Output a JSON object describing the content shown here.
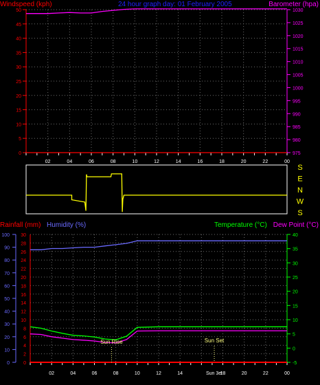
{
  "header": {
    "windspeed_label": "Windspeed (kph)",
    "title": "24 hour graph day: 01 February 2005",
    "barometer_label": "Barometer (hpa)"
  },
  "lower_header": {
    "rainfall_label": "Rainfall (mm)",
    "humidity_label": "Humidity (%)",
    "temperature_label": "Temperature (°C)",
    "dewpoint_label": "Dew Point (°C)"
  },
  "compass": [
    "S",
    "E",
    "N",
    "W",
    "S"
  ],
  "x_ticks": [
    "02",
    "04",
    "06",
    "08",
    "10",
    "12",
    "14",
    "16",
    "18",
    "20",
    "22",
    "00"
  ],
  "annotations": {
    "sun_rise": "Sun Rise",
    "sun_set": "Sun Set",
    "sun_set_axis": "Sun 3et"
  },
  "colors": {
    "background": "#000000",
    "grid": "#6e6e6e",
    "windspeed": "#ff0000",
    "barometer": "#ff00ff",
    "title": "#2020ff",
    "wind_direction": "#ffff00",
    "humidity": "#6a6aff",
    "temperature": "#00ff00",
    "dewpoint": "#ff00ff",
    "rainfall": "#ff0000"
  },
  "chart_data": [
    {
      "type": "line",
      "panel": "top",
      "title": "24 hour graph day: 01 February 2005",
      "xlabel": "",
      "x_ticks": [
        "02",
        "04",
        "06",
        "08",
        "10",
        "12",
        "14",
        "16",
        "18",
        "20",
        "22",
        "00"
      ],
      "xlim": [
        0,
        24
      ],
      "left_axis": {
        "label": "Windspeed (kph)",
        "ylim": [
          0,
          50
        ],
        "ticks": [
          0,
          5,
          10,
          15,
          20,
          25,
          30,
          35,
          40,
          45,
          50
        ]
      },
      "right_axis": {
        "label": "Barometer (hpa)",
        "ylim": [
          975,
          1030
        ],
        "ticks": [
          975,
          980,
          985,
          990,
          995,
          1000,
          1005,
          1010,
          1015,
          1020,
          1025,
          1030
        ]
      },
      "grid": true,
      "series": [
        {
          "name": "Windspeed (kph)",
          "axis": "left",
          "points": [
            [
              0,
              0
            ],
            [
              24,
              0
            ]
          ]
        },
        {
          "name": "Barometer (hpa)",
          "axis": "right",
          "points": [
            [
              0,
              1028.5
            ],
            [
              2,
              1028.5
            ],
            [
              3,
              1028.7
            ],
            [
              4,
              1028.9
            ],
            [
              5,
              1028.7
            ],
            [
              6,
              1028.7
            ],
            [
              7,
              1029.3
            ],
            [
              8,
              1029.7
            ],
            [
              9,
              1030.1
            ],
            [
              10,
              1030.3
            ],
            [
              12,
              1030.3
            ],
            [
              14,
              1030.3
            ],
            [
              16,
              1030.3
            ],
            [
              18,
              1030.3
            ],
            [
              20,
              1030.3
            ],
            [
              22,
              1030.3
            ],
            [
              24,
              1030.3
            ]
          ]
        }
      ]
    },
    {
      "type": "line",
      "panel": "wind_direction",
      "title": "",
      "x_ticks": [],
      "xlim": [
        0,
        24
      ],
      "y_categories": [
        "S",
        "E",
        "N",
        "W",
        "S"
      ],
      "grid": false,
      "series": [
        {
          "name": "",
          "axis": "direction",
          "points": [
            [
              0,
              1.5
            ],
            [
              4.2,
              1.5
            ],
            [
              4.2,
              1.1
            ],
            [
              5.4,
              0.9
            ],
            [
              5.5,
              0.15
            ],
            [
              5.55,
              3.3
            ],
            [
              5.6,
              3.1
            ],
            [
              7.8,
              3.1
            ],
            [
              7.85,
              3.35
            ],
            [
              8.8,
              3.35
            ],
            [
              8.85,
              0.05
            ],
            [
              8.9,
              1.15
            ],
            [
              9.0,
              1.5
            ],
            [
              24,
              1.5
            ]
          ]
        }
      ]
    },
    {
      "type": "line",
      "panel": "bottom",
      "title": "",
      "x_ticks": [
        "02",
        "04",
        "06",
        "08",
        "10",
        "12",
        "14",
        "16",
        "18",
        "20",
        "22",
        "00"
      ],
      "xlim": [
        0,
        24
      ],
      "rain_axis": {
        "label": "Rainfall (mm)",
        "ylim": [
          0,
          30
        ],
        "ticks": [
          0,
          2,
          4,
          6,
          8,
          10,
          12,
          14,
          16,
          18,
          20,
          22,
          24,
          26,
          28,
          30
        ]
      },
      "humidity_axis": {
        "label": "Humidity (%)",
        "ylim": [
          0,
          100
        ],
        "ticks": [
          0,
          10,
          20,
          30,
          40,
          50,
          60,
          70,
          80,
          90,
          100
        ]
      },
      "temp_axis": {
        "label": "Temperature (°C)",
        "ylim": [
          -5,
          40
        ],
        "ticks": [
          -5,
          0,
          5,
          10,
          15,
          20,
          25,
          30,
          35,
          40
        ]
      },
      "grid": true,
      "annotations": [
        {
          "label": "Sun Rise",
          "x": 7.6
        },
        {
          "label": "Sun Set",
          "x": 17.2
        }
      ],
      "series": [
        {
          "name": "Humidity (%)",
          "axis": "humidity",
          "points": [
            [
              0,
              88
            ],
            [
              1,
              88
            ],
            [
              2,
              89
            ],
            [
              3,
              89
            ],
            [
              4,
              89.5
            ],
            [
              5,
              90
            ],
            [
              6,
              90
            ],
            [
              7,
              91
            ],
            [
              8,
              92
            ],
            [
              9,
              93
            ],
            [
              10,
              95
            ],
            [
              12,
              95
            ],
            [
              16,
              95
            ],
            [
              20,
              95
            ],
            [
              24,
              95
            ]
          ]
        },
        {
          "name": "Temperature (°C)",
          "axis": "temp",
          "points": [
            [
              0,
              7.5
            ],
            [
              1,
              7.0
            ],
            [
              2,
              6.0
            ],
            [
              3,
              5.2
            ],
            [
              4,
              4.5
            ],
            [
              5,
              4.3
            ],
            [
              6,
              3.9
            ],
            [
              7,
              3.2
            ],
            [
              8,
              2.9
            ],
            [
              9,
              4.2
            ],
            [
              10,
              7.3
            ],
            [
              12,
              7.5
            ],
            [
              16,
              7.5
            ],
            [
              20,
              7.5
            ],
            [
              24,
              7.5
            ]
          ]
        },
        {
          "name": "Dew Point (°C)",
          "axis": "temp",
          "points": [
            [
              0,
              5.0
            ],
            [
              1,
              4.8
            ],
            [
              2,
              4.0
            ],
            [
              3,
              3.5
            ],
            [
              4,
              3.0
            ],
            [
              5,
              2.8
            ],
            [
              6,
              2.5
            ],
            [
              7,
              2.0
            ],
            [
              8,
              1.8
            ],
            [
              9,
              3.0
            ],
            [
              10,
              6.0
            ],
            [
              12,
              6.1
            ],
            [
              16,
              6.1
            ],
            [
              20,
              6.1
            ],
            [
              24,
              6.1
            ]
          ]
        },
        {
          "name": "Rainfall (mm)",
          "axis": "rain",
          "points": [
            [
              0,
              0
            ],
            [
              24,
              0
            ]
          ]
        }
      ]
    }
  ]
}
